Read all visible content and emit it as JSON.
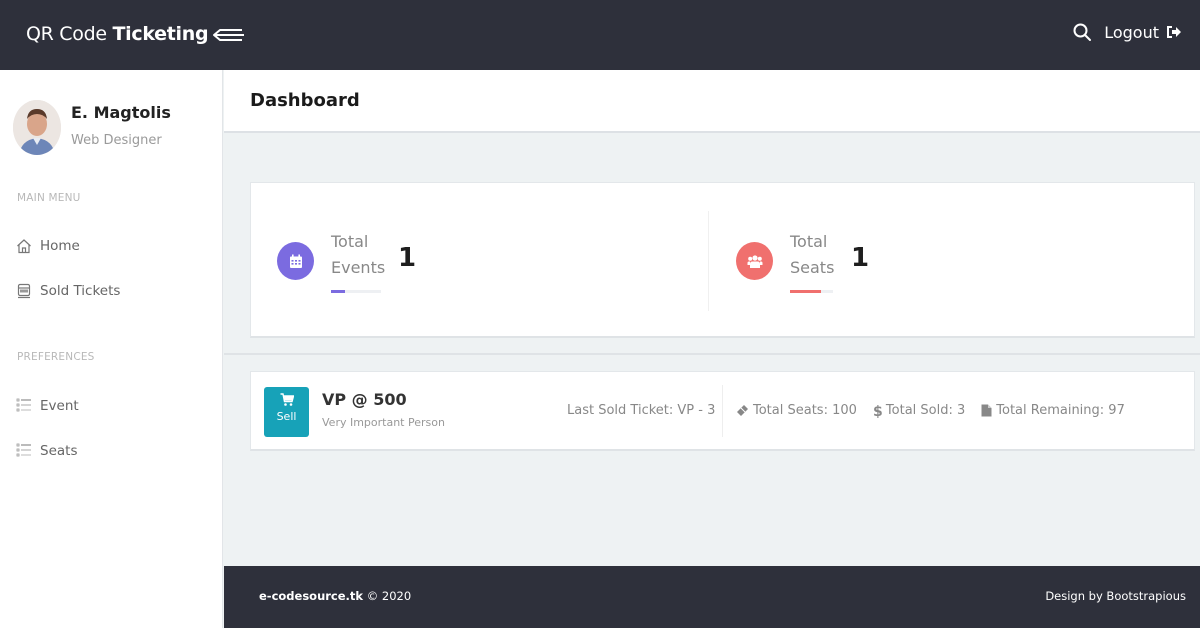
{
  "app": {
    "brand_light": "QR Code ",
    "brand_bold": "Ticketing",
    "logout_label": "Logout"
  },
  "user": {
    "name": "E. Magtolis",
    "role": "Web Designer"
  },
  "sidebar": {
    "sections": [
      {
        "label": "MAIN MENU",
        "items": [
          {
            "label": "Home",
            "icon": "home-icon"
          },
          {
            "label": "Sold Tickets",
            "icon": "train-icon"
          }
        ]
      },
      {
        "label": "PREFERENCES",
        "items": [
          {
            "label": "Event",
            "icon": "list-icon"
          },
          {
            "label": "Seats",
            "icon": "list-icon"
          }
        ]
      }
    ]
  },
  "page": {
    "title": "Dashboard"
  },
  "stats": [
    {
      "label_line1": "Total",
      "label_line2": "Events",
      "value": "1",
      "icon": "calendar-icon",
      "color": "#7b6be0",
      "progress": 0.28
    },
    {
      "label_line1": "Total",
      "label_line2": "Seats",
      "value": "1",
      "icon": "users-icon",
      "color": "#f0706e",
      "progress": 0.72
    }
  ],
  "tickets": [
    {
      "name": "VP @ 500",
      "description": "Very Important Person",
      "sell_label": "Sell",
      "last_sold": "Last Sold Ticket: VP - 3",
      "total_seats": "Total Seats: 100",
      "total_sold": "Total Sold: 3",
      "total_remaining": "Total Remaining: 97"
    }
  ],
  "footer": {
    "site": "e-codesource.tk",
    "copyright": " © 2020",
    "credit": "Design by Bootstrapious"
  },
  "colors": {
    "topbar": "#2e303b",
    "accent_teal": "#17a2b8",
    "events_purple": "#7b6be0",
    "seats_red": "#f0706e",
    "background": "#eef2f3"
  }
}
